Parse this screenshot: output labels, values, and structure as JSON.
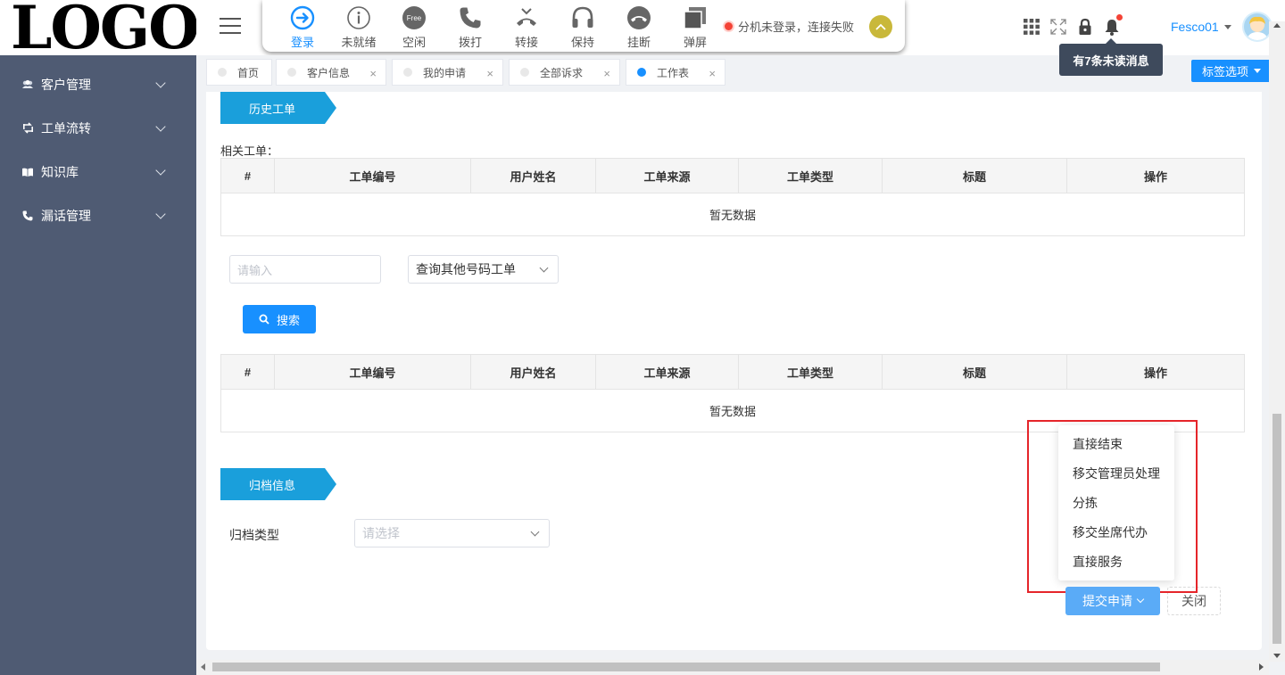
{
  "logo": {
    "text": "LOGO"
  },
  "sidebar": {
    "items": [
      {
        "label": "客户管理",
        "icon": "users-icon"
      },
      {
        "label": "工单流转",
        "icon": "workflow-icon"
      },
      {
        "label": "知识库",
        "icon": "book-icon"
      },
      {
        "label": "漏话管理",
        "icon": "phone-icon"
      }
    ]
  },
  "phonebar": {
    "buttons": [
      {
        "label": "登录",
        "icon": "login-icon"
      },
      {
        "label": "未就绪",
        "icon": "info-icon"
      },
      {
        "label": "空闲",
        "icon": "free-icon",
        "badge": "Free"
      },
      {
        "label": "拨打",
        "icon": "phone-icon"
      },
      {
        "label": "转接",
        "icon": "transfer-icon"
      },
      {
        "label": "保持",
        "icon": "headset-icon"
      },
      {
        "label": "挂断",
        "icon": "hangup-icon"
      },
      {
        "label": "弹屏",
        "icon": "popup-screen-icon"
      }
    ],
    "status": "分机未登录，连接失败"
  },
  "header": {
    "username": "Fesco01",
    "tooltip": "有7条未读消息"
  },
  "tabs": [
    {
      "label": "首页",
      "closable": false
    },
    {
      "label": "客户信息",
      "closable": true
    },
    {
      "label": "我的申请",
      "closable": true
    },
    {
      "label": "全部诉求",
      "closable": true
    },
    {
      "label": "工作表",
      "closable": true,
      "active": true
    }
  ],
  "tag_options_label": "标签选项",
  "history": {
    "title": "历史工单",
    "related_label": "相关工单：",
    "columns": [
      "#",
      "工单编号",
      "用户姓名",
      "工单来源",
      "工单类型",
      "标题",
      "操作"
    ],
    "empty_text": "暂无数据"
  },
  "search": {
    "placeholder": "请输入",
    "select_value": "查询其他号码工单",
    "button_label": "搜索"
  },
  "result_table": {
    "columns": [
      "#",
      "工单编号",
      "用户姓名",
      "工单来源",
      "工单类型",
      "标题",
      "操作"
    ],
    "empty_text": "暂无数据"
  },
  "archive": {
    "title": "归档信息",
    "type_label": "归档类型",
    "type_placeholder": "请选择"
  },
  "dropdown_menu": {
    "items": [
      "直接结束",
      "移交管理员处理",
      "分拣",
      "移交坐席代办",
      "直接服务"
    ]
  },
  "actions": {
    "submit_label": "提交申请",
    "close_label": "关闭"
  },
  "colors": {
    "accent": "#1890ff",
    "sidebar_bg": "#4f5b73",
    "banner": "#1a9fdb",
    "highlight_box": "#e5252a"
  }
}
